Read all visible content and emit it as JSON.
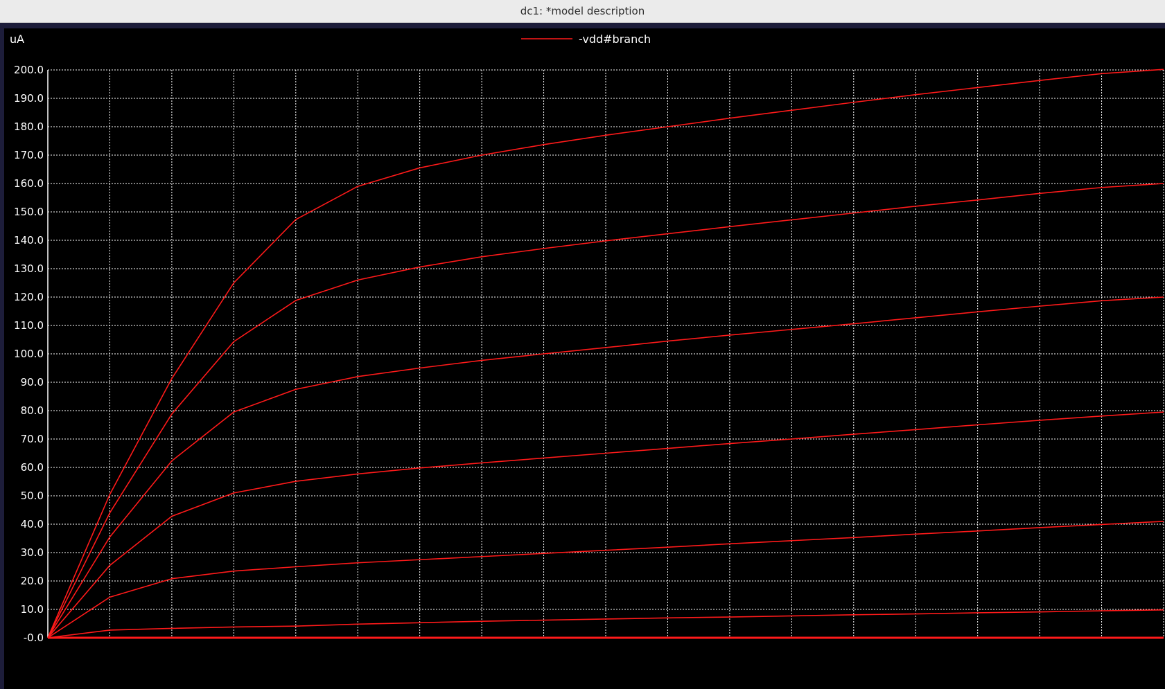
{
  "window": {
    "title": "dc1: *model description"
  },
  "colors": {
    "trace": "#ff1a1a",
    "grid": "#ffffff",
    "background": "#000000",
    "text": "#ffffff"
  },
  "chart_data": {
    "type": "line",
    "title": "",
    "ylabel": "uA",
    "xlabel": "",
    "ylim": [
      0,
      200
    ],
    "xlim": [
      0,
      1.8
    ],
    "grid": true,
    "legend": {
      "position": "top-center",
      "entries": [
        "-vdd#branch"
      ]
    },
    "y_tick_labels": [
      "-0.0",
      "10.0",
      "20.0",
      "30.0",
      "40.0",
      "50.0",
      "60.0",
      "70.0",
      "80.0",
      "90.0",
      "100.0",
      "110.0",
      "120.0",
      "130.0",
      "140.0",
      "150.0",
      "160.0",
      "170.0",
      "180.0",
      "190.0",
      "200.0"
    ],
    "y_ticks": [
      0,
      10,
      20,
      30,
      40,
      50,
      60,
      70,
      80,
      90,
      100,
      110,
      120,
      130,
      140,
      150,
      160,
      170,
      180,
      190,
      200
    ],
    "x_ticks": [
      0,
      0.1,
      0.2,
      0.3,
      0.4,
      0.5,
      0.6,
      0.7,
      0.8,
      0.9,
      1.0,
      1.1,
      1.2,
      1.3,
      1.4,
      1.5,
      1.6,
      1.7,
      1.8
    ],
    "x": [
      0,
      0.1,
      0.2,
      0.3,
      0.4,
      0.5,
      0.6,
      0.7,
      0.8,
      0.9,
      1.0,
      1.1,
      1.2,
      1.3,
      1.4,
      1.5,
      1.6,
      1.7,
      1.8
    ],
    "series": [
      {
        "values": [
          0,
          0,
          0,
          0,
          0,
          0,
          0,
          0,
          0,
          0,
          0,
          0,
          0,
          0,
          0,
          0,
          0,
          0,
          0
        ]
      },
      {
        "values": [
          0,
          2.7,
          3.3,
          3.8,
          4.1,
          4.8,
          5.3,
          5.8,
          6.2,
          6.6,
          7.0,
          7.3,
          7.7,
          8.1,
          8.4,
          8.8,
          9.1,
          9.5,
          9.8
        ]
      },
      {
        "values": [
          0,
          14.3,
          20.8,
          23.5,
          25.0,
          26.4,
          27.5,
          28.6,
          29.7,
          30.8,
          31.9,
          33.1,
          34.2,
          35.3,
          36.5,
          37.6,
          38.8,
          39.9,
          41.0
        ]
      },
      {
        "values": [
          0,
          25.5,
          42.8,
          51.0,
          55.1,
          57.7,
          59.8,
          61.6,
          63.3,
          65.0,
          66.7,
          68.4,
          70.0,
          71.7,
          73.3,
          75.0,
          76.6,
          78.1,
          79.5
        ]
      },
      {
        "values": [
          0,
          35.5,
          62.3,
          79.5,
          87.5,
          92.0,
          95.0,
          97.7,
          100.0,
          102.2,
          104.5,
          106.6,
          108.6,
          110.6,
          112.7,
          114.8,
          116.8,
          118.7,
          120.0
        ]
      },
      {
        "values": [
          0,
          44.0,
          78.8,
          104.3,
          118.8,
          126.0,
          130.6,
          134.2,
          137.1,
          139.8,
          142.3,
          144.8,
          147.2,
          149.6,
          152.0,
          154.2,
          156.5,
          158.6,
          160.0
        ]
      },
      {
        "values": [
          0,
          50.5,
          91.3,
          125.0,
          147.3,
          159.0,
          165.5,
          170.0,
          173.7,
          177.0,
          180.0,
          183.0,
          185.8,
          188.6,
          191.3,
          193.8,
          196.3,
          198.7,
          200.2
        ]
      }
    ]
  }
}
